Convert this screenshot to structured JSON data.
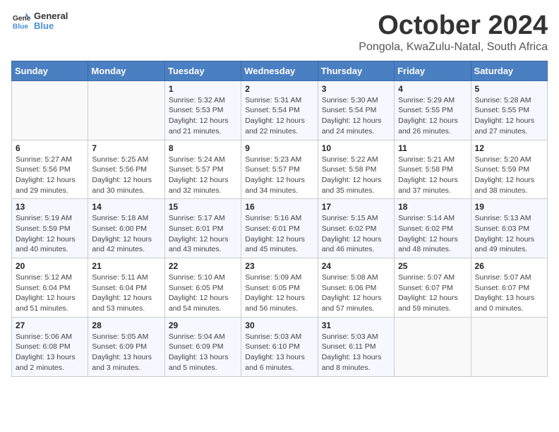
{
  "header": {
    "logo_line1": "General",
    "logo_line2": "Blue",
    "month_title": "October 2024",
    "subtitle": "Pongola, KwaZulu-Natal, South Africa"
  },
  "calendar": {
    "days_of_week": [
      "Sunday",
      "Monday",
      "Tuesday",
      "Wednesday",
      "Thursday",
      "Friday",
      "Saturday"
    ],
    "weeks": [
      [
        {
          "num": "",
          "sunrise": "",
          "sunset": "",
          "daylight": ""
        },
        {
          "num": "",
          "sunrise": "",
          "sunset": "",
          "daylight": ""
        },
        {
          "num": "1",
          "sunrise": "Sunrise: 5:32 AM",
          "sunset": "Sunset: 5:53 PM",
          "daylight": "Daylight: 12 hours and 21 minutes."
        },
        {
          "num": "2",
          "sunrise": "Sunrise: 5:31 AM",
          "sunset": "Sunset: 5:54 PM",
          "daylight": "Daylight: 12 hours and 22 minutes."
        },
        {
          "num": "3",
          "sunrise": "Sunrise: 5:30 AM",
          "sunset": "Sunset: 5:54 PM",
          "daylight": "Daylight: 12 hours and 24 minutes."
        },
        {
          "num": "4",
          "sunrise": "Sunrise: 5:29 AM",
          "sunset": "Sunset: 5:55 PM",
          "daylight": "Daylight: 12 hours and 26 minutes."
        },
        {
          "num": "5",
          "sunrise": "Sunrise: 5:28 AM",
          "sunset": "Sunset: 5:55 PM",
          "daylight": "Daylight: 12 hours and 27 minutes."
        }
      ],
      [
        {
          "num": "6",
          "sunrise": "Sunrise: 5:27 AM",
          "sunset": "Sunset: 5:56 PM",
          "daylight": "Daylight: 12 hours and 29 minutes."
        },
        {
          "num": "7",
          "sunrise": "Sunrise: 5:25 AM",
          "sunset": "Sunset: 5:56 PM",
          "daylight": "Daylight: 12 hours and 30 minutes."
        },
        {
          "num": "8",
          "sunrise": "Sunrise: 5:24 AM",
          "sunset": "Sunset: 5:57 PM",
          "daylight": "Daylight: 12 hours and 32 minutes."
        },
        {
          "num": "9",
          "sunrise": "Sunrise: 5:23 AM",
          "sunset": "Sunset: 5:57 PM",
          "daylight": "Daylight: 12 hours and 34 minutes."
        },
        {
          "num": "10",
          "sunrise": "Sunrise: 5:22 AM",
          "sunset": "Sunset: 5:58 PM",
          "daylight": "Daylight: 12 hours and 35 minutes."
        },
        {
          "num": "11",
          "sunrise": "Sunrise: 5:21 AM",
          "sunset": "Sunset: 5:58 PM",
          "daylight": "Daylight: 12 hours and 37 minutes."
        },
        {
          "num": "12",
          "sunrise": "Sunrise: 5:20 AM",
          "sunset": "Sunset: 5:59 PM",
          "daylight": "Daylight: 12 hours and 38 minutes."
        }
      ],
      [
        {
          "num": "13",
          "sunrise": "Sunrise: 5:19 AM",
          "sunset": "Sunset: 5:59 PM",
          "daylight": "Daylight: 12 hours and 40 minutes."
        },
        {
          "num": "14",
          "sunrise": "Sunrise: 5:18 AM",
          "sunset": "Sunset: 6:00 PM",
          "daylight": "Daylight: 12 hours and 42 minutes."
        },
        {
          "num": "15",
          "sunrise": "Sunrise: 5:17 AM",
          "sunset": "Sunset: 6:01 PM",
          "daylight": "Daylight: 12 hours and 43 minutes."
        },
        {
          "num": "16",
          "sunrise": "Sunrise: 5:16 AM",
          "sunset": "Sunset: 6:01 PM",
          "daylight": "Daylight: 12 hours and 45 minutes."
        },
        {
          "num": "17",
          "sunrise": "Sunrise: 5:15 AM",
          "sunset": "Sunset: 6:02 PM",
          "daylight": "Daylight: 12 hours and 46 minutes."
        },
        {
          "num": "18",
          "sunrise": "Sunrise: 5:14 AM",
          "sunset": "Sunset: 6:02 PM",
          "daylight": "Daylight: 12 hours and 48 minutes."
        },
        {
          "num": "19",
          "sunrise": "Sunrise: 5:13 AM",
          "sunset": "Sunset: 6:03 PM",
          "daylight": "Daylight: 12 hours and 49 minutes."
        }
      ],
      [
        {
          "num": "20",
          "sunrise": "Sunrise: 5:12 AM",
          "sunset": "Sunset: 6:04 PM",
          "daylight": "Daylight: 12 hours and 51 minutes."
        },
        {
          "num": "21",
          "sunrise": "Sunrise: 5:11 AM",
          "sunset": "Sunset: 6:04 PM",
          "daylight": "Daylight: 12 hours and 53 minutes."
        },
        {
          "num": "22",
          "sunrise": "Sunrise: 5:10 AM",
          "sunset": "Sunset: 6:05 PM",
          "daylight": "Daylight: 12 hours and 54 minutes."
        },
        {
          "num": "23",
          "sunrise": "Sunrise: 5:09 AM",
          "sunset": "Sunset: 6:05 PM",
          "daylight": "Daylight: 12 hours and 56 minutes."
        },
        {
          "num": "24",
          "sunrise": "Sunrise: 5:08 AM",
          "sunset": "Sunset: 6:06 PM",
          "daylight": "Daylight: 12 hours and 57 minutes."
        },
        {
          "num": "25",
          "sunrise": "Sunrise: 5:07 AM",
          "sunset": "Sunset: 6:07 PM",
          "daylight": "Daylight: 12 hours and 59 minutes."
        },
        {
          "num": "26",
          "sunrise": "Sunrise: 5:07 AM",
          "sunset": "Sunset: 6:07 PM",
          "daylight": "Daylight: 13 hours and 0 minutes."
        }
      ],
      [
        {
          "num": "27",
          "sunrise": "Sunrise: 5:06 AM",
          "sunset": "Sunset: 6:08 PM",
          "daylight": "Daylight: 13 hours and 2 minutes."
        },
        {
          "num": "28",
          "sunrise": "Sunrise: 5:05 AM",
          "sunset": "Sunset: 6:09 PM",
          "daylight": "Daylight: 13 hours and 3 minutes."
        },
        {
          "num": "29",
          "sunrise": "Sunrise: 5:04 AM",
          "sunset": "Sunset: 6:09 PM",
          "daylight": "Daylight: 13 hours and 5 minutes."
        },
        {
          "num": "30",
          "sunrise": "Sunrise: 5:03 AM",
          "sunset": "Sunset: 6:10 PM",
          "daylight": "Daylight: 13 hours and 6 minutes."
        },
        {
          "num": "31",
          "sunrise": "Sunrise: 5:03 AM",
          "sunset": "Sunset: 6:11 PM",
          "daylight": "Daylight: 13 hours and 8 minutes."
        },
        {
          "num": "",
          "sunrise": "",
          "sunset": "",
          "daylight": ""
        },
        {
          "num": "",
          "sunrise": "",
          "sunset": "",
          "daylight": ""
        }
      ]
    ]
  }
}
